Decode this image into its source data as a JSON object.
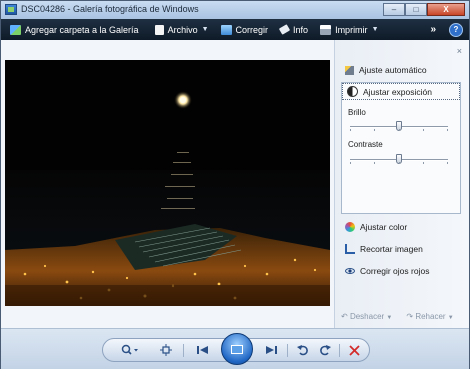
{
  "window": {
    "title": "DSC04286 - Galería fotográfica de Windows",
    "controls": {
      "minimize": "‒",
      "maximize": "□",
      "close": "X"
    }
  },
  "toolbar": {
    "add_folder": "Agregar carpeta a la Galería",
    "file": "Archivo",
    "fix": "Corregir",
    "info": "Info",
    "print": "Imprimir",
    "more": "»",
    "help": "?"
  },
  "panel": {
    "close": "×",
    "auto_adjust": "Ajuste automático",
    "adjust_exposure": "Ajustar exposición",
    "brightness_label": "Brillo",
    "contrast_label": "Contraste",
    "brightness_level": 0.5,
    "contrast_level": 0.5,
    "adjust_color": "Ajustar color",
    "crop_image": "Recortar imagen",
    "red_eye": "Corregir ojos rojos",
    "undo": "Deshacer",
    "redo": "Rehacer"
  },
  "colors": {
    "toolbar_bg": "#14202e",
    "accent": "#1f66c4",
    "delete_red": "#d32a2a"
  },
  "icons": {
    "zoom": "magnifier-icon",
    "actual_size": "fit-window-icon",
    "previous": "previous-icon",
    "slideshow": "slideshow-icon",
    "next": "next-icon",
    "rotate_ccw": "rotate-left-icon",
    "rotate_cw": "rotate-right-icon",
    "delete": "delete-icon"
  }
}
